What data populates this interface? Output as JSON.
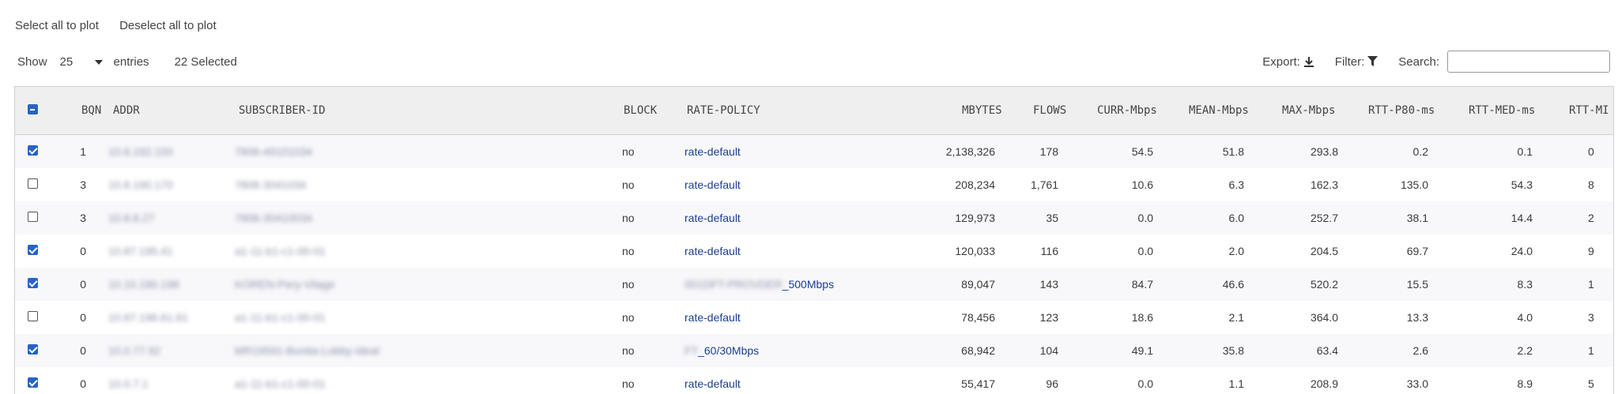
{
  "top_links": {
    "select_all": "Select all to plot",
    "deselect_all": "Deselect all to plot"
  },
  "toolbar": {
    "show_label": "Show",
    "page_size": "25",
    "entries_label": "entries",
    "selected": "22 Selected",
    "export_label": "Export:",
    "filter_label": "Filter:",
    "search_label": "Search:",
    "search_value": ""
  },
  "icons": {
    "export": "download-icon",
    "filter": "funnel-icon",
    "page_size_caret": "chevron-down-icon"
  },
  "colors": {
    "accent": "#2563c9",
    "policy_link": "#1a3f8f"
  },
  "table": {
    "header_checkbox": "partial",
    "columns": [
      "BQN",
      "ADDR",
      "SUBSCRIBER-ID",
      "BLOCK",
      "RATE-POLICY",
      "MBYTES",
      "FLOWS",
      "CURR-Mbps",
      "MEAN-Mbps",
      "MAX-Mbps",
      "RTT-P80-ms",
      "RTT-MED-ms",
      "RTT-MI"
    ],
    "rows": [
      {
        "checked": true,
        "bqn": "1",
        "addr": "10.8.192.150",
        "sub": "7806-49101034",
        "block": "no",
        "policy": "rate-default",
        "policy_blur": "",
        "mbytes": "2,138,326",
        "flows": "178",
        "curr": "54.5",
        "mean": "51.8",
        "max": "293.8",
        "p80": "0.2",
        "med": "0.1",
        "mi": "0"
      },
      {
        "checked": false,
        "bqn": "3",
        "addr": "10.8.190.170",
        "sub": "7806-3041034",
        "block": "no",
        "policy": "rate-default",
        "policy_blur": "",
        "mbytes": "208,234",
        "flows": "1,761",
        "curr": "10.6",
        "mean": "6.3",
        "max": "162.3",
        "p80": "135.0",
        "med": "54.3",
        "mi": "8"
      },
      {
        "checked": false,
        "bqn": "3",
        "addr": "10.8.8.27",
        "sub": "7806-30410034",
        "block": "no",
        "policy": "rate-default",
        "policy_blur": "",
        "mbytes": "129,973",
        "flows": "35",
        "curr": "0.0",
        "mean": "6.0",
        "max": "252.7",
        "p80": "38.1",
        "med": "14.4",
        "mi": "2"
      },
      {
        "checked": true,
        "bqn": "0",
        "addr": "10.87.195.41",
        "sub": "a1-11-b1-c1-00-01",
        "block": "no",
        "policy": "rate-default",
        "policy_blur": "",
        "mbytes": "120,033",
        "flows": "116",
        "curr": "0.0",
        "mean": "2.0",
        "max": "204.5",
        "p80": "69.7",
        "med": "24.0",
        "mi": "9"
      },
      {
        "checked": true,
        "bqn": "0",
        "addr": "10.10.180.198",
        "sub": "KOREN-Pery-Vilage",
        "block": "no",
        "policy": "_500Mbps",
        "policy_blur": "001DFT-PROVDER",
        "mbytes": "89,047",
        "flows": "143",
        "curr": "84.7",
        "mean": "46.6",
        "max": "520.2",
        "p80": "15.5",
        "med": "8.3",
        "mi": "1"
      },
      {
        "checked": false,
        "bqn": "0",
        "addr": "10.87.196.61.61",
        "sub": "a1-11-b1-c1-00-01",
        "block": "no",
        "policy": "rate-default",
        "policy_blur": "",
        "mbytes": "78,456",
        "flows": "123",
        "curr": "18.6",
        "mean": "2.1",
        "max": "364.0",
        "p80": "13.3",
        "med": "4.0",
        "mi": "3"
      },
      {
        "checked": true,
        "bqn": "0",
        "addr": "10.0.77.92",
        "sub": "MR19591-Bonita-Lobby-Ideal",
        "block": "no",
        "policy": "_60/30Mbps",
        "policy_blur": "FT",
        "mbytes": "68,942",
        "flows": "104",
        "curr": "49.1",
        "mean": "35.8",
        "max": "63.4",
        "p80": "2.6",
        "med": "2.2",
        "mi": "1"
      },
      {
        "checked": true,
        "bqn": "0",
        "addr": "10.0.7.1",
        "sub": "a1-11-b1-c1-00-01",
        "block": "no",
        "policy": "rate-default",
        "policy_blur": "",
        "mbytes": "55,417",
        "flows": "96",
        "curr": "0.0",
        "mean": "1.1",
        "max": "208.9",
        "p80": "33.0",
        "med": "8.9",
        "mi": "5"
      }
    ]
  }
}
